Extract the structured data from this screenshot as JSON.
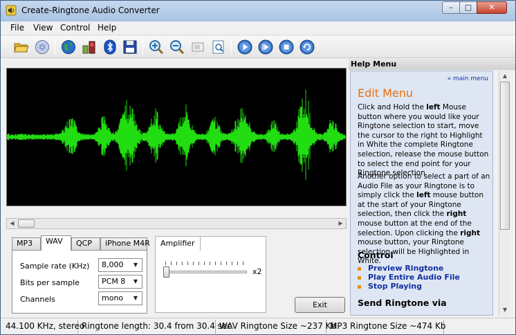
{
  "window": {
    "title": "Create-Ringtone Audio Converter"
  },
  "window_controls": {
    "minimize": "–",
    "maximize": "□",
    "close": "✕"
  },
  "menu": [
    "File",
    "View",
    "Control",
    "Help"
  ],
  "toolbar_icons": [
    "open-folder-icon",
    "cd-icon",
    "globe-icon",
    "phone-icon",
    "bluetooth-icon",
    "save-icon",
    "zoom-in-icon",
    "zoom-out-icon",
    "zoom-selection-icon",
    "zoom-fit-icon",
    "play-icon",
    "play-selection-icon",
    "stop-icon",
    "loop-icon"
  ],
  "format_tabs": [
    "MP3",
    "WAV",
    "QCP",
    "iPhone M4R"
  ],
  "active_tab": "WAV",
  "settings": {
    "sample_rate_label": "Sample rate (KHz)",
    "sample_rate_value": "8,000",
    "bits_label": "Bits per sample",
    "bits_value": "PCM 8",
    "channels_label": "Channels",
    "channels_value": "mono"
  },
  "amplifier": {
    "label": "Amplifier",
    "max_label": "x2",
    "level": 0.0
  },
  "exit_label": "Exit",
  "status": {
    "audio_format": "44.100 KHz, stereo",
    "ringtone_length": "Ringtone length: 30.4 from 30.4 sec",
    "wav_size": "WAV Ringtone Size ~237 Kb",
    "mp3_size": "MP3 Ringtone Size ~474 Kb"
  },
  "help": {
    "header": "Help Menu",
    "main_menu_link": "« main menu",
    "title": "Edit Menu",
    "para1": [
      "Click and Hold the ",
      "left",
      " Mouse button where you would like your Ringtone selection to start, move the cursor to the right to Highlight in White the complete Ringtone selection, release the mouse button to select the end point for your Ringtone selection."
    ],
    "para2": [
      "Another option to select a part of an Audio File as your Ringtone is to simply click the ",
      "left",
      " mouse button at the start of your Ringtone selection, then click the ",
      "right",
      " mouse button at the end of the selection. Upon clicking the ",
      "right",
      " mouse button, your Ringtone selection will be Highlighted in White."
    ],
    "control_heading": "Control",
    "control_links": [
      "Preview Ringtone",
      "Play Entire Audio File",
      "Stop Playing"
    ],
    "send_heading": "Send Ringtone via"
  },
  "colors": {
    "waveform": "#22dd11",
    "help_title": "#e9700d",
    "help_link": "#1030a0"
  }
}
